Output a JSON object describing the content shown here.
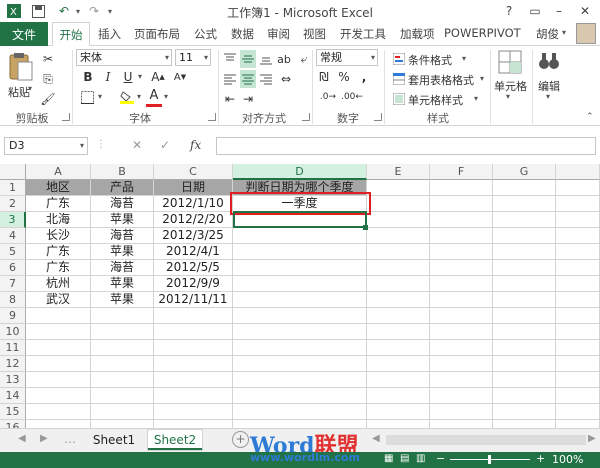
{
  "window": {
    "title": "工作簿1 - Microsoft Excel"
  },
  "tabs": {
    "file": "文件",
    "home": "开始",
    "insert": "插入",
    "layout": "页面布局",
    "formulas": "公式",
    "data": "数据",
    "review": "审阅",
    "view": "视图",
    "developer": "开发工具",
    "addins": "加载项",
    "powerpivot": "POWERPIVOT",
    "user": "胡俊"
  },
  "ribbon": {
    "paste": "粘贴",
    "font_name": "宋体",
    "font_size": "11",
    "number_format": "常规",
    "conditional_format": "条件格式",
    "format_table": "套用表格格式",
    "cell_styles": "单元格样式",
    "cells": "单元格",
    "editing": "编辑",
    "groups": {
      "clipboard": "剪贴板",
      "font": "字体",
      "alignment": "对齐方式",
      "number": "数字",
      "styles": "样式"
    }
  },
  "formula_bar": {
    "name_box": "D3",
    "fx": "fx",
    "content": ""
  },
  "grid": {
    "columns": [
      "A",
      "B",
      "C",
      "D",
      "E",
      "F",
      "G"
    ],
    "rows": [
      "1",
      "2",
      "3",
      "4",
      "5",
      "6",
      "7",
      "8",
      "9",
      "10",
      "11",
      "12",
      "13",
      "14",
      "15",
      "16"
    ],
    "header_row": [
      "地区",
      "产品",
      "日期",
      "判断日期为哪个季度"
    ],
    "data": [
      [
        "广东",
        "海苔",
        "2012/1/10",
        "一季度"
      ],
      [
        "北海",
        "苹果",
        "2012/2/20",
        ""
      ],
      [
        "长沙",
        "海苔",
        "2012/3/25",
        ""
      ],
      [
        "广东",
        "苹果",
        "2012/4/1",
        ""
      ],
      [
        "广东",
        "海苔",
        "2012/5/5",
        ""
      ],
      [
        "杭州",
        "苹果",
        "2012/9/9",
        ""
      ],
      [
        "武汉",
        "苹果",
        "2012/11/11",
        ""
      ]
    ]
  },
  "sheets": {
    "sheet1": "Sheet1",
    "sheet2": "Sheet2"
  },
  "status": {
    "zoom": "100%"
  },
  "watermark": {
    "word": "Word",
    "cn": "联盟",
    "url": "www.wordlm.com"
  },
  "colors": {
    "accent": "#217346",
    "highlight": "#e02020",
    "header_fill": "#a6a6a6"
  }
}
